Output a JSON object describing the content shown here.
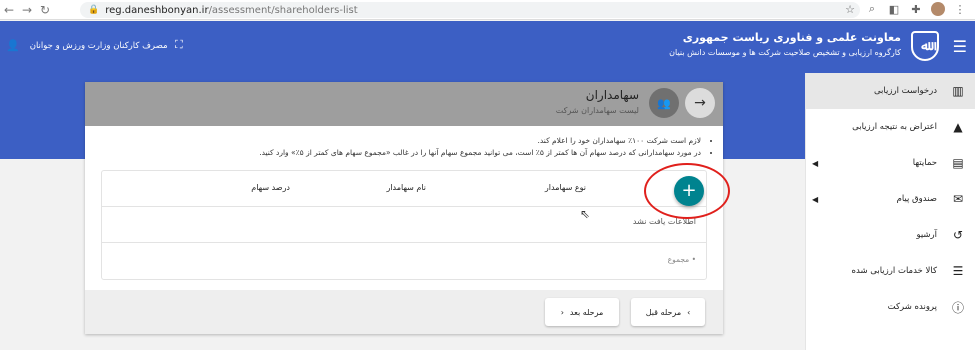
{
  "browser": {
    "url_host": "reg.daneshbonyan.ir",
    "url_path": "/assessment/shareholders-list"
  },
  "header": {
    "title": "معاونت علمی و فناوری ریاست جمهوری",
    "subtitle": "کارگروه ارزیابی و تشخیص صلاحیت شرکت ها و موسسات دانش بنیان",
    "user_label": "مصرف کارکنان وزارت ورزش و جوانان",
    "colors": {
      "primary": "#3c5fc4",
      "accent": "#00838f",
      "annotation": "#e0201c"
    }
  },
  "sidebar": {
    "items": [
      {
        "label": "درخواست ارزیابی",
        "icon": "bar-chart-icon",
        "active": true
      },
      {
        "label": "اعتراض به نتیجه ارزیابی",
        "icon": "warning-icon"
      },
      {
        "label": "حمایتها",
        "icon": "gift-icon",
        "expandable": true
      },
      {
        "label": "صندوق پیام",
        "icon": "mail-icon",
        "expandable": true
      },
      {
        "label": "آرشیو",
        "icon": "history-icon"
      },
      {
        "label": "کالا خدمات ارزیابی شده",
        "icon": "list-icon"
      },
      {
        "label": "پرونده شرکت",
        "icon": "info-icon"
      }
    ]
  },
  "card": {
    "title": "سهامداران",
    "subtitle": "لیست سهامداران شرکت",
    "notes": [
      "لازم است شرکت ۱۰۰٪ سهامداران خود را اعلام کند.",
      "در مورد سهامدارانی که درصد سهام آن ها کمتر از ۵٪ است، می توانید مجموع سهام آنها را در غالب «مجموع سهام های کمتر از ۵٪» وارد کنید."
    ],
    "table": {
      "columns": [
        "نوع سهامدار",
        "نام سهامدار",
        "درصد سهام"
      ],
      "empty_text": "اطلاعات یافت نشد",
      "sum_label": "• مجموع"
    },
    "buttons": {
      "prev": "مرحله قبل",
      "next": "مرحله بعد"
    }
  }
}
